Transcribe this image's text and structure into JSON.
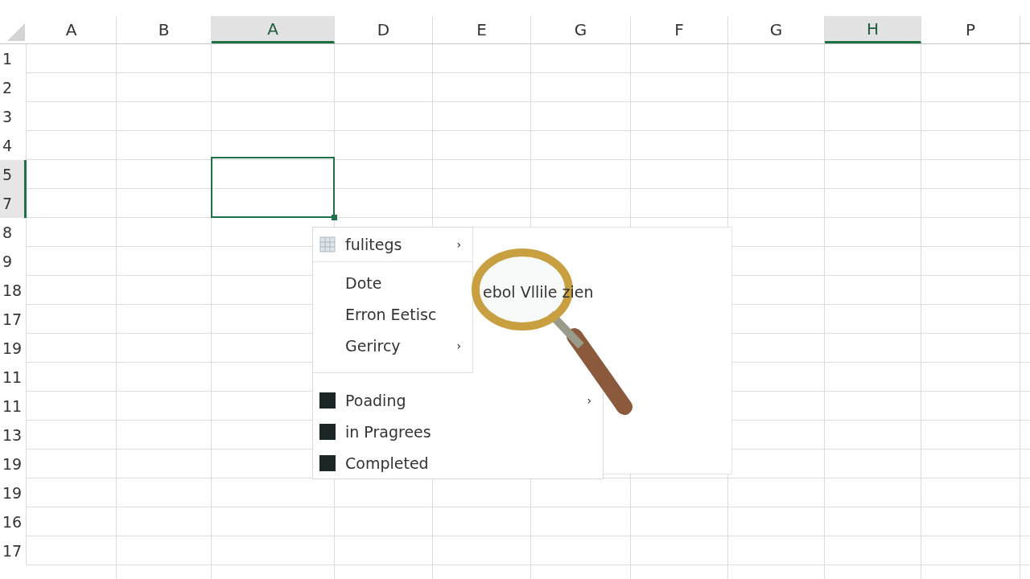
{
  "columns": [
    {
      "label": "A",
      "selected": false
    },
    {
      "label": "B",
      "selected": false
    },
    {
      "label": "A",
      "selected": true
    },
    {
      "label": "D",
      "selected": false
    },
    {
      "label": "E",
      "selected": false
    },
    {
      "label": "G",
      "selected": false
    },
    {
      "label": "F",
      "selected": false
    },
    {
      "label": "G",
      "selected": false
    },
    {
      "label": "H",
      "selected": true
    },
    {
      "label": "P",
      "selected": false
    }
  ],
  "rows": [
    {
      "label": "1",
      "selected": false
    },
    {
      "label": "2",
      "selected": false
    },
    {
      "label": "3",
      "selected": false
    },
    {
      "label": "4",
      "selected": false
    },
    {
      "label": "5",
      "selected": true
    },
    {
      "label": "7",
      "selected": true
    },
    {
      "label": "8",
      "selected": false
    },
    {
      "label": "9",
      "selected": false
    },
    {
      "label": "18",
      "selected": false
    },
    {
      "label": "17",
      "selected": false
    },
    {
      "label": "19",
      "selected": false
    },
    {
      "label": "11",
      "selected": false
    },
    {
      "label": "11",
      "selected": false
    },
    {
      "label": "13",
      "selected": false
    },
    {
      "label": "19",
      "selected": false
    },
    {
      "label": "19",
      "selected": false
    },
    {
      "label": "16",
      "selected": false
    },
    {
      "label": "17",
      "selected": false
    }
  ],
  "context_menu": {
    "items": [
      {
        "kind": "header",
        "label": "fulitegs",
        "arrow": "›"
      },
      {
        "kind": "item",
        "label": "Dote"
      },
      {
        "kind": "item",
        "label": "Erron Eetisc"
      },
      {
        "kind": "item",
        "label": "Gerircy",
        "arrow": "›"
      },
      {
        "kind": "status",
        "label": "Poading",
        "arrow": "›"
      },
      {
        "kind": "status",
        "label": "in Pragrees"
      },
      {
        "kind": "status",
        "label": "Completed"
      }
    ],
    "submenu_text": "ebol Vllile zien"
  }
}
